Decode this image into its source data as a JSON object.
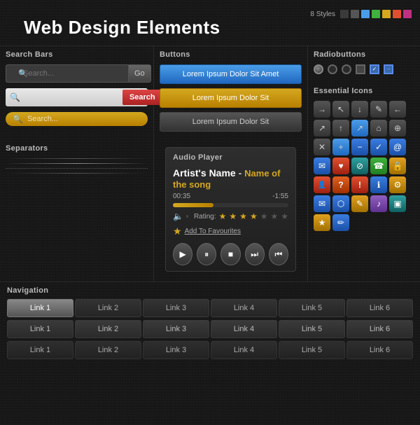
{
  "header": {
    "title": "Web Design Elements",
    "styles_label": "8 Styles",
    "swatches": [
      "#3a3a3a",
      "#555",
      "#777",
      "#4a9de8",
      "#40b040",
      "#d4a820",
      "#e05030",
      "#c03080"
    ]
  },
  "search_bars": {
    "section_title": "Search Bars",
    "bar1": {
      "placeholder": "Search...",
      "btn_label": "Go"
    },
    "bar2": {
      "placeholder": "",
      "btn_label": "Search"
    },
    "bar3": {
      "placeholder": "Search..."
    }
  },
  "separators": {
    "section_title": "Separators"
  },
  "buttons": {
    "section_title": "Buttons",
    "btn1": "Lorem Ipsum Dolor Sit Amet",
    "btn2": "Lorem Ipsum Dolor Sit",
    "btn3": "Lorem Ipsum Dolor Sit"
  },
  "radiobuttons": {
    "section_title": "Radiobuttons"
  },
  "essential_icons": {
    "section_title": "Essential Icons",
    "icons": [
      {
        "name": "arrow-right-icon",
        "symbol": "→",
        "style": "dark"
      },
      {
        "name": "cursor-icon",
        "symbol": "↖",
        "style": "dark"
      },
      {
        "name": "download-icon",
        "symbol": "↓",
        "style": "dark"
      },
      {
        "name": "pencil-icon",
        "symbol": "✎",
        "style": "dark"
      },
      {
        "name": "arrow-left-icon",
        "symbol": "←",
        "style": "dark"
      },
      {
        "name": "pointer-icon",
        "symbol": "↗",
        "style": "dark"
      },
      {
        "name": "arrow-up-icon",
        "symbol": "↑",
        "style": "dark"
      },
      {
        "name": "external-link-icon",
        "symbol": "↗",
        "style": "dark"
      },
      {
        "name": "home-icon",
        "symbol": "⌂",
        "style": "dark"
      },
      {
        "name": "zoom-icon",
        "symbol": "⊕",
        "style": "dark"
      },
      {
        "name": "close-icon",
        "symbol": "✕",
        "style": "dark"
      },
      {
        "name": "plus-icon",
        "symbol": "+",
        "style": "dark"
      },
      {
        "name": "minus-icon",
        "symbol": "−",
        "style": "blue"
      },
      {
        "name": "check-icon",
        "symbol": "✓",
        "style": "blue"
      },
      {
        "name": "at-icon",
        "symbol": "@",
        "style": "blue"
      },
      {
        "name": "chat-icon",
        "symbol": "✉",
        "style": "blue"
      },
      {
        "name": "heart-icon",
        "symbol": "♥",
        "style": "red"
      },
      {
        "name": "no-icon",
        "symbol": "⊘",
        "style": "teal"
      },
      {
        "name": "phone-icon",
        "symbol": "☎",
        "style": "green"
      },
      {
        "name": "lock-icon",
        "symbol": "🔒",
        "style": "yellow"
      },
      {
        "name": "person-icon",
        "symbol": "👤",
        "style": "red"
      },
      {
        "name": "question-icon",
        "symbol": "?",
        "style": "orange"
      },
      {
        "name": "warning-icon",
        "symbol": "!",
        "style": "red"
      },
      {
        "name": "info-icon",
        "symbol": "ℹ",
        "style": "blue"
      },
      {
        "name": "gear-icon",
        "symbol": "⚙",
        "style": "yellow"
      },
      {
        "name": "mail-icon",
        "symbol": "✉",
        "style": "blue"
      },
      {
        "name": "shield-icon",
        "symbol": "⬡",
        "style": "blue"
      },
      {
        "name": "edit-icon",
        "symbol": "✎",
        "style": "yellow"
      },
      {
        "name": "music-icon",
        "symbol": "♪",
        "style": "purple"
      },
      {
        "name": "image-icon",
        "symbol": "▣",
        "style": "teal"
      },
      {
        "name": "star-icon",
        "symbol": "★",
        "style": "yellow"
      },
      {
        "name": "bookmark-icon",
        "symbol": "✏",
        "style": "blue"
      }
    ]
  },
  "audio_player": {
    "section_title": "Audio Player",
    "artist": "Artist's Name",
    "dash": " - ",
    "song": "Name of the song",
    "time_current": "00:35",
    "time_total": "-1:55",
    "rating_label": "Rating:",
    "fav_label": "Add To Favourites",
    "controls": [
      "play",
      "pause",
      "stop",
      "next",
      "prev"
    ]
  },
  "navigation": {
    "section_title": "Navigation",
    "row1": [
      "Link 1",
      "Link 2",
      "Link 3",
      "Link 4",
      "Link 5",
      "Link 6"
    ],
    "row2": [
      "Link 1",
      "Link 2",
      "Link 3",
      "Link 4",
      "Link 5",
      "Link 6"
    ],
    "row3": [
      "Link 1",
      "Link 2",
      "Link 3",
      "Link 4",
      "Link 5",
      "Link 6"
    ]
  }
}
